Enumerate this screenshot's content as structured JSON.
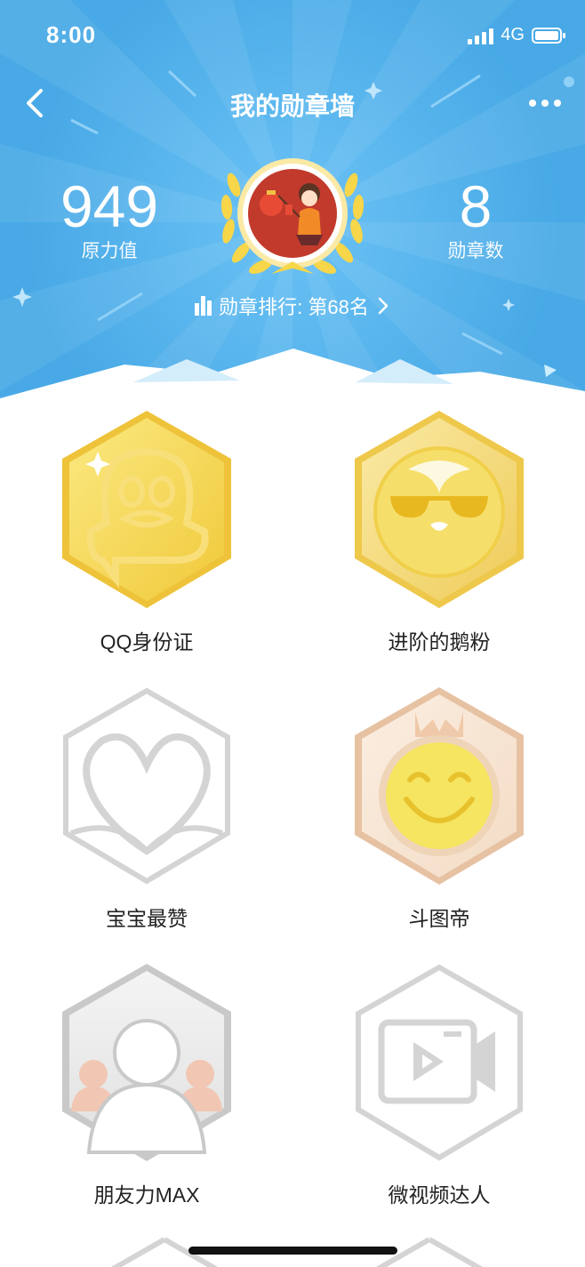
{
  "status_bar": {
    "time": "8:00",
    "network": "4G"
  },
  "header": {
    "title": "我的勋章墙",
    "left_stat": {
      "value": "949",
      "label": "原力值"
    },
    "right_stat": {
      "value": "8",
      "label": "勋章数"
    },
    "rank_text": "勋章排行: 第68名"
  },
  "colors": {
    "header_bg": "#4fb0ea",
    "gold": "#f3d558",
    "peach": "#efc9a9",
    "inactive": "#d4d4d4"
  },
  "badges": [
    {
      "label": "QQ身份证",
      "icon": "qq-penguin-gold-icon",
      "earned": true
    },
    {
      "label": "进阶的鹅粉",
      "icon": "penguin-sunglasses-gold-icon",
      "earned": true
    },
    {
      "label": "宝宝最赞",
      "icon": "heart-outline-icon",
      "earned": false
    },
    {
      "label": "斗图帝",
      "icon": "smiley-crown-icon",
      "earned": true
    },
    {
      "label": "朋友力MAX",
      "icon": "friends-silhouette-icon",
      "earned": true
    },
    {
      "label": "微视频达人",
      "icon": "video-camera-icon",
      "earned": false
    }
  ]
}
